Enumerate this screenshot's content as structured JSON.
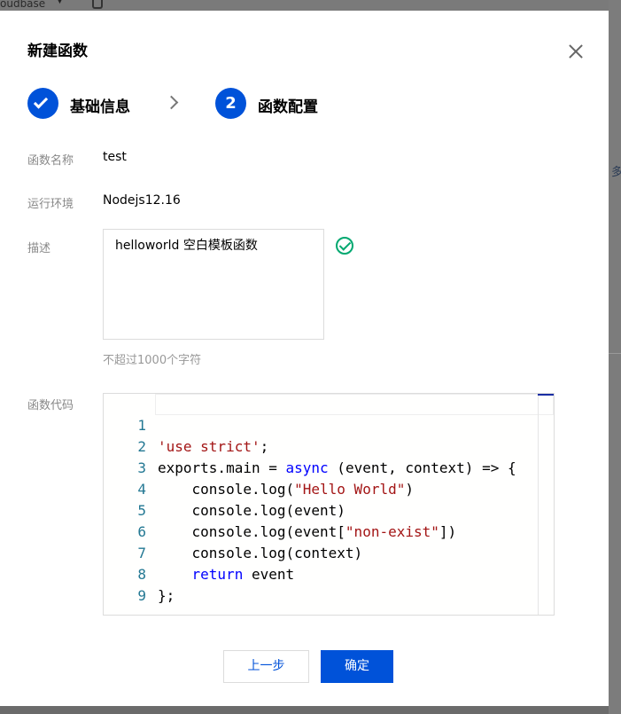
{
  "background": {
    "app_label": "oudbase",
    "right_edge_char": "多"
  },
  "modal": {
    "title": "新建函数",
    "steps": [
      {
        "label": "基础信息",
        "state": "completed"
      },
      {
        "number": "2",
        "label": "函数配置",
        "state": "active"
      }
    ],
    "form": {
      "name_label": "函数名称",
      "name_value": "test",
      "runtime_label": "运行环境",
      "runtime_value": "Nodejs12.16",
      "desc_label": "描述",
      "desc_value": "helloworld 空白模板函数",
      "desc_hint": "不超过1000个字符",
      "code_label": "函数代码"
    },
    "code": {
      "line_numbers": [
        "1",
        "2",
        "3",
        "4",
        "5",
        "6",
        "7",
        "8",
        "9"
      ],
      "lines": [
        [
          "'use strict'",
          ";"
        ],
        [
          "exports.main = ",
          "async",
          " (event, context) => {"
        ],
        [
          "    console.log(",
          "\"Hello World\"",
          ")"
        ],
        [
          "    console.log(event)"
        ],
        [
          "    console.log(event[",
          "\"non-exist\"",
          "])"
        ],
        [
          "    console.log(context)"
        ],
        [
          "    ",
          "return",
          " event"
        ],
        [
          "};"
        ],
        [
          ""
        ]
      ]
    },
    "buttons": {
      "prev_label": "上一步",
      "confirm_label": "确定"
    }
  },
  "colors": {
    "primary": "#0052d9",
    "success": "#00a870",
    "string_token": "#a31515",
    "keyword_token": "#0000ff",
    "line_number": "#237893"
  },
  "icons": [
    "close-icon",
    "check-icon",
    "chevron-right-icon",
    "check-circle-icon",
    "caret-down-icon",
    "lock-icon"
  ]
}
